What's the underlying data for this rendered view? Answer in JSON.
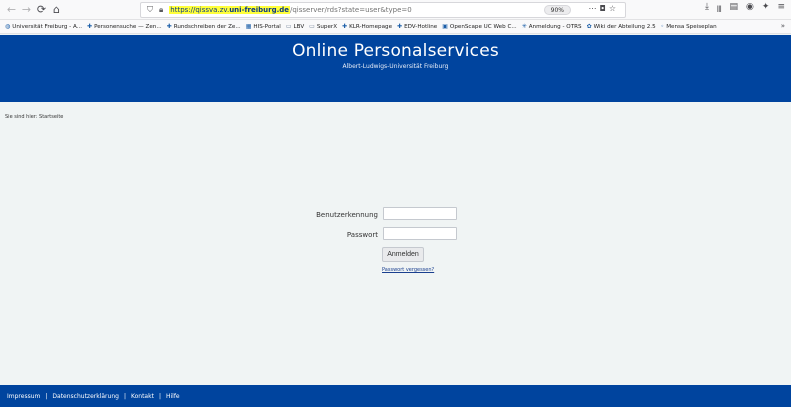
{
  "browser": {
    "url_host_pre": "https://qissva.zv.",
    "url_host_bold": "uni-freiburg.de",
    "url_path": "/qisserver/rds?state=user&type=0",
    "zoom": "90%",
    "bookmarks": [
      {
        "label": "Universität Freiburg - A...",
        "icon": "globe-icon"
      },
      {
        "label": "Personensuche — Zen...",
        "icon": "bookmark-icon"
      },
      {
        "label": "Rundschreiben der Ze...",
        "icon": "bookmark-icon"
      },
      {
        "label": "HIS-Portal",
        "icon": "bookmark-icon"
      },
      {
        "label": "LBV",
        "icon": "folder-icon"
      },
      {
        "label": "SuperX",
        "icon": "folder-icon"
      },
      {
        "label": "KLR-Homepage",
        "icon": "bookmark-icon"
      },
      {
        "label": "EDV-Hotline",
        "icon": "bookmark-icon"
      },
      {
        "label": "OpenScape UC Web C...",
        "icon": "bookmark-icon"
      },
      {
        "label": "Anmeldung - OTRS",
        "icon": "bookmark-icon"
      },
      {
        "label": "Wiki der Abteilung 2.5",
        "icon": "bookmark-icon"
      },
      {
        "label": "Mensa Speiseplan",
        "icon": "bookmark-icon"
      }
    ]
  },
  "header": {
    "title": "Online Personalservices",
    "subtitle": "Albert-Ludwigs-Universität Freiburg"
  },
  "breadcrumb": "Sie sind hier: Startseite",
  "login": {
    "username_label": "Benutzerkennung",
    "password_label": "Passwort",
    "submit_label": "Anmelden",
    "forgot_label": "Passwort vergessen?"
  },
  "footer": {
    "links": [
      "Impressum",
      "Datenschutzerklärung",
      "Kontakt",
      "Hilfe"
    ]
  },
  "colors": {
    "header_bg": "#00449e",
    "page_bg": "#f0f4f4"
  }
}
